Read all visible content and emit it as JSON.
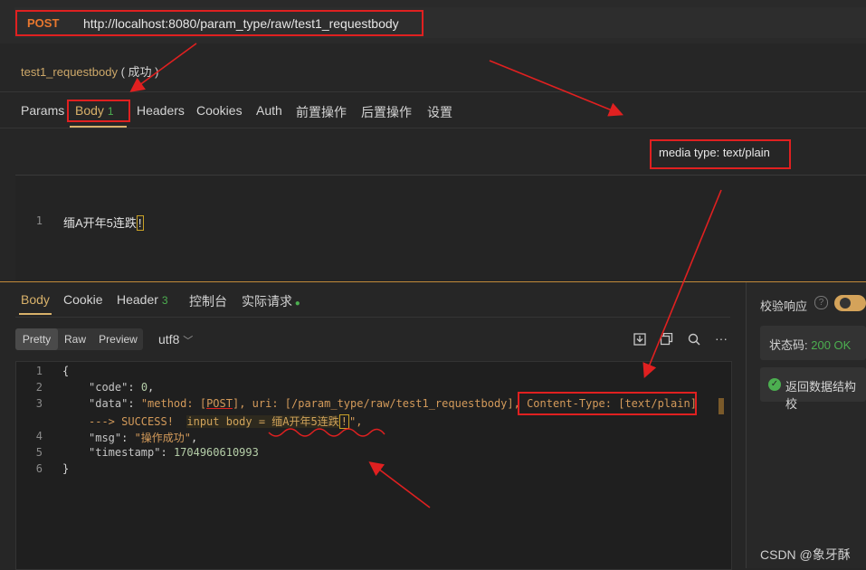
{
  "request": {
    "method": "POST",
    "url": "http://localhost:8080/param_type/raw/test1_requestbody",
    "name": "test1_requestbody",
    "result": "( 成功 )"
  },
  "request_tabs": [
    {
      "label": "Params"
    },
    {
      "label": "Body",
      "badge": "1"
    },
    {
      "label": "Headers"
    },
    {
      "label": "Cookies"
    },
    {
      "label": "Auth"
    },
    {
      "label": "前置操作"
    },
    {
      "label": "后置操作"
    },
    {
      "label": "设置"
    }
  ],
  "media_type": "media type: text/plain",
  "request_body": {
    "line_no": "1",
    "text": "缅A开年5连跌",
    "highlight": "!"
  },
  "response_tabs": [
    {
      "label": "Body"
    },
    {
      "label": "Cookie"
    },
    {
      "label": "Header",
      "badge": "3"
    },
    {
      "label": "控制台"
    },
    {
      "label": "实际请求"
    }
  ],
  "view_modes": [
    "Pretty",
    "Raw",
    "Preview"
  ],
  "encoding": "utf8",
  "response_lines": {
    "l1": "{",
    "l2_key": "\"code\"",
    "l2_val": "0",
    "l3_key": "\"data\"",
    "l3_a": "\"method: [",
    "l3_b": "POST",
    "l3_c": "], uri: [/param_type/raw/test1_requestbody], ",
    "l3_d": "Content-Type: [text/plain]",
    "l3w_a": "---> SUCCESS!  ",
    "l3w_b": "input body = 缅A开年5连跌",
    "l3w_c": "!",
    "l3w_d": "\",",
    "l4_key": "\"msg\"",
    "l4_val": "\"操作成功\"",
    "l5_key": "\"timestamp\"",
    "l5_val": "1704960610993",
    "l6": "}"
  },
  "line_numbers": [
    "1",
    "2",
    "3",
    "4",
    "5",
    "6"
  ],
  "right_panel": {
    "validate_label": "校验响应",
    "status_label": "状态码:",
    "status_value": "200 OK",
    "valid_text": "返回数据结构校"
  },
  "watermark": "CSDN @象牙酥",
  "icons": [
    "download-icon",
    "copy-icon",
    "search-icon",
    "more-icon",
    "help-icon",
    "check-circle-icon",
    "chevron-down-icon"
  ],
  "colors": {
    "accent": "#d8b16a",
    "method": "#e8772e",
    "annotation": "#e02020",
    "success": "#4caf50"
  }
}
